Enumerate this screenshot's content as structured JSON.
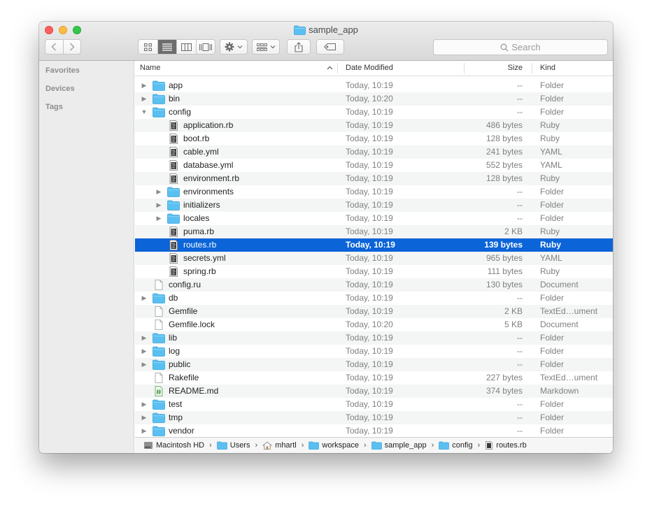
{
  "window": {
    "title": "sample_app"
  },
  "toolbar": {
    "search_placeholder": "Search",
    "icons": {
      "back": "chevron-left-icon",
      "forward": "chevron-right-icon",
      "action": "gear-icon",
      "share": "share-icon",
      "tag": "tag-icon"
    }
  },
  "sidebar": {
    "sections": [
      "Favorites",
      "Devices",
      "Tags"
    ]
  },
  "columns": {
    "name": "Name",
    "date": "Date Modified",
    "size": "Size",
    "kind": "Kind"
  },
  "colors": {
    "selection": "#0b64d8",
    "folder": "#5ac0f2"
  },
  "rows": [
    {
      "name": "app",
      "date": "Today, 10:19",
      "size": "--",
      "kind": "Folder",
      "depth": 0,
      "type": "folder",
      "disclosure": "collapsed"
    },
    {
      "name": "bin",
      "date": "Today, 10:20",
      "size": "--",
      "kind": "Folder",
      "depth": 0,
      "type": "folder",
      "disclosure": "collapsed"
    },
    {
      "name": "config",
      "date": "Today, 10:19",
      "size": "--",
      "kind": "Folder",
      "depth": 0,
      "type": "folder",
      "disclosure": "expanded"
    },
    {
      "name": "application.rb",
      "date": "Today, 10:19",
      "size": "486 bytes",
      "kind": "Ruby",
      "depth": 1,
      "type": "code",
      "disclosure": "none"
    },
    {
      "name": "boot.rb",
      "date": "Today, 10:19",
      "size": "128 bytes",
      "kind": "Ruby",
      "depth": 1,
      "type": "code",
      "disclosure": "none"
    },
    {
      "name": "cable.yml",
      "date": "Today, 10:19",
      "size": "241 bytes",
      "kind": "YAML",
      "depth": 1,
      "type": "code",
      "disclosure": "none"
    },
    {
      "name": "database.yml",
      "date": "Today, 10:19",
      "size": "552 bytes",
      "kind": "YAML",
      "depth": 1,
      "type": "code",
      "disclosure": "none"
    },
    {
      "name": "environment.rb",
      "date": "Today, 10:19",
      "size": "128 bytes",
      "kind": "Ruby",
      "depth": 1,
      "type": "code",
      "disclosure": "none"
    },
    {
      "name": "environments",
      "date": "Today, 10:19",
      "size": "--",
      "kind": "Folder",
      "depth": 1,
      "type": "folder",
      "disclosure": "collapsed"
    },
    {
      "name": "initializers",
      "date": "Today, 10:19",
      "size": "--",
      "kind": "Folder",
      "depth": 1,
      "type": "folder",
      "disclosure": "collapsed"
    },
    {
      "name": "locales",
      "date": "Today, 10:19",
      "size": "--",
      "kind": "Folder",
      "depth": 1,
      "type": "folder",
      "disclosure": "collapsed"
    },
    {
      "name": "puma.rb",
      "date": "Today, 10:19",
      "size": "2 KB",
      "kind": "Ruby",
      "depth": 1,
      "type": "code",
      "disclosure": "none"
    },
    {
      "name": "routes.rb",
      "date": "Today, 10:19",
      "size": "139 bytes",
      "kind": "Ruby",
      "depth": 1,
      "type": "code",
      "disclosure": "none",
      "selected": true
    },
    {
      "name": "secrets.yml",
      "date": "Today, 10:19",
      "size": "965 bytes",
      "kind": "YAML",
      "depth": 1,
      "type": "code",
      "disclosure": "none"
    },
    {
      "name": "spring.rb",
      "date": "Today, 10:19",
      "size": "111 bytes",
      "kind": "Ruby",
      "depth": 1,
      "type": "code",
      "disclosure": "none"
    },
    {
      "name": "config.ru",
      "date": "Today, 10:19",
      "size": "130 bytes",
      "kind": "Document",
      "depth": 0,
      "type": "doc",
      "disclosure": "none"
    },
    {
      "name": "db",
      "date": "Today, 10:19",
      "size": "--",
      "kind": "Folder",
      "depth": 0,
      "type": "folder",
      "disclosure": "collapsed"
    },
    {
      "name": "Gemfile",
      "date": "Today, 10:19",
      "size": "2 KB",
      "kind": "TextEd…ument",
      "depth": 0,
      "type": "doc",
      "disclosure": "none"
    },
    {
      "name": "Gemfile.lock",
      "date": "Today, 10:20",
      "size": "5 KB",
      "kind": "Document",
      "depth": 0,
      "type": "doc",
      "disclosure": "none"
    },
    {
      "name": "lib",
      "date": "Today, 10:19",
      "size": "--",
      "kind": "Folder",
      "depth": 0,
      "type": "folder",
      "disclosure": "collapsed"
    },
    {
      "name": "log",
      "date": "Today, 10:19",
      "size": "--",
      "kind": "Folder",
      "depth": 0,
      "type": "folder",
      "disclosure": "collapsed"
    },
    {
      "name": "public",
      "date": "Today, 10:19",
      "size": "--",
      "kind": "Folder",
      "depth": 0,
      "type": "folder",
      "disclosure": "collapsed"
    },
    {
      "name": "Rakefile",
      "date": "Today, 10:19",
      "size": "227 bytes",
      "kind": "TextEd…ument",
      "depth": 0,
      "type": "doc",
      "disclosure": "none"
    },
    {
      "name": "README.md",
      "date": "Today, 10:19",
      "size": "374 bytes",
      "kind": "Markdown",
      "depth": 0,
      "type": "markdown",
      "disclosure": "none"
    },
    {
      "name": "test",
      "date": "Today, 10:19",
      "size": "--",
      "kind": "Folder",
      "depth": 0,
      "type": "folder",
      "disclosure": "collapsed"
    },
    {
      "name": "tmp",
      "date": "Today, 10:19",
      "size": "--",
      "kind": "Folder",
      "depth": 0,
      "type": "folder",
      "disclosure": "collapsed"
    },
    {
      "name": "vendor",
      "date": "Today, 10:19",
      "size": "--",
      "kind": "Folder",
      "depth": 0,
      "type": "folder",
      "disclosure": "collapsed"
    }
  ],
  "pathbar": [
    {
      "label": "Macintosh HD",
      "icon": "hard-drive-icon"
    },
    {
      "label": "Users",
      "icon": "folder-icon"
    },
    {
      "label": "mhartl",
      "icon": "home-icon"
    },
    {
      "label": "workspace",
      "icon": "folder-icon"
    },
    {
      "label": "sample_app",
      "icon": "folder-icon"
    },
    {
      "label": "config",
      "icon": "folder-icon"
    },
    {
      "label": "routes.rb",
      "icon": "code-file-icon"
    }
  ]
}
